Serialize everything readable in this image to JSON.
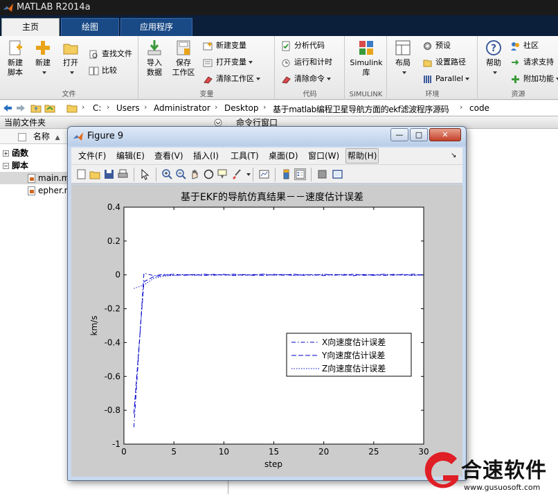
{
  "app": {
    "title": "MATLAB R2014a",
    "tabs": [
      {
        "label": "主页",
        "active": true
      },
      {
        "label": "绘图",
        "active": false
      },
      {
        "label": "应用程序",
        "active": false
      }
    ]
  },
  "ribbon": {
    "file_group": {
      "new_script": "新建\n脚本",
      "new": "新建",
      "open": "打开",
      "find_files": "查找文件",
      "compare": "比较",
      "label": "文件"
    },
    "variable_group": {
      "import_data": "导入\n数据",
      "save_workspace": "保存\n工作区",
      "new_variable": "新建变量",
      "open_variable": "打开变量",
      "clear_workspace": "清除工作区",
      "label": "变量"
    },
    "code_group": {
      "analyze_code": "分析代码",
      "run_and_time": "运行和计时",
      "clear_commands": "清除命令",
      "label": "代码"
    },
    "simulink_group": {
      "simulink_lib": "Simulink\n库",
      "label": "SIMULINK"
    },
    "env_group": {
      "layout": "布局",
      "preferences": "预设",
      "set_path": "设置路径",
      "parallel": "Parallel",
      "label": "环境"
    },
    "resources_group": {
      "help": "帮助",
      "community": "社区",
      "request_support": "请求支持",
      "add_ons": "附加功能",
      "label": "资源"
    }
  },
  "address": {
    "crumbs": [
      "C:",
      "Users",
      "Administrator",
      "Desktop",
      "基于matlab编程卫星导航方面的ekf滤波程序源码",
      "code"
    ]
  },
  "left_panel": {
    "title": "当前文件夹",
    "column_name": "名称",
    "column_sort": "▲",
    "rows": [
      {
        "label": "函数",
        "type": "group",
        "expander": "+"
      },
      {
        "label": "脚本",
        "type": "group",
        "expander": "−"
      },
      {
        "label": "main.m",
        "type": "file"
      },
      {
        "label": "epher.m",
        "type": "file"
      }
    ]
  },
  "command_window": {
    "title": "命令行窗口"
  },
  "figure": {
    "title": "Figure 9",
    "menu": [
      "文件(F)",
      "编辑(E)",
      "查看(V)",
      "插入(I)",
      "工具(T)",
      "桌面(D)",
      "窗口(W)",
      "帮助(H)"
    ],
    "highlighted_menu_index": 7,
    "min_glyph": "—",
    "max_glyph": "□",
    "close_glyph": "✕",
    "toolbar_icons": [
      "new-figure-icon",
      "open-file-icon",
      "save-icon",
      "print-icon",
      "pointer-icon",
      "zoom-in-icon",
      "zoom-out-icon",
      "pan-icon",
      "rotate-3d-icon",
      "data-cursor-icon",
      "brush-icon",
      "link-plot-icon",
      "colorbar-icon",
      "legend-icon",
      "hide-plot-tools-icon",
      "show-plot-tools-icon"
    ]
  },
  "chart_data": {
    "type": "line",
    "title": "基于EKF的导航仿真结果－－速度估计误差",
    "xlabel": "step",
    "ylabel": "km/s",
    "xlim": [
      0,
      30
    ],
    "ylim": [
      -1,
      0.4
    ],
    "xticks": [
      0,
      5,
      10,
      15,
      20,
      25,
      30
    ],
    "yticks": [
      -1,
      -0.8,
      -0.6,
      -0.4,
      -0.2,
      0,
      0.2,
      0.4
    ],
    "legend_position": "lower-right",
    "series": [
      {
        "name": "X向速度估计误差",
        "style": "dashdot",
        "color": "#0000cc",
        "x": [
          1,
          2,
          3,
          4,
          5,
          6,
          7,
          8,
          9,
          10,
          11,
          12,
          13,
          14,
          15,
          16,
          17,
          18,
          19,
          20,
          21,
          22,
          23,
          24,
          25,
          26,
          27,
          28,
          29,
          30
        ],
        "y": [
          -0.9,
          0.01,
          -0.005,
          0.003,
          -0.004,
          0.002,
          -0.003,
          0.004,
          -0.002,
          0.003,
          -0.004,
          0.002,
          -0.003,
          0.005,
          -0.002,
          0.003,
          -0.004,
          0.002,
          -0.003,
          0.004,
          -0.002,
          0.003,
          -0.005,
          0.002,
          -0.003,
          0.004,
          -0.002,
          0.003,
          -0.004,
          0.002
        ]
      },
      {
        "name": "Y向速度估计误差",
        "style": "dashed",
        "color": "#0000cc",
        "x": [
          1,
          2,
          3,
          4,
          5,
          6,
          7,
          8,
          9,
          10,
          11,
          12,
          13,
          14,
          15,
          16,
          17,
          18,
          19,
          20,
          21,
          22,
          23,
          24,
          25,
          26,
          27,
          28,
          29,
          30
        ],
        "y": [
          -0.82,
          -0.04,
          -0.01,
          -0.002,
          0.004,
          -0.003,
          0.002,
          -0.004,
          0.003,
          -0.002,
          0.004,
          -0.003,
          0.002,
          -0.004,
          0.003,
          -0.002,
          0.004,
          -0.003,
          0.002,
          -0.004,
          0.003,
          -0.002,
          0.004,
          -0.003,
          0.002,
          -0.004,
          0.003,
          -0.002,
          0.004,
          -0.003
        ]
      },
      {
        "name": "Z向速度估计误差",
        "style": "dotted",
        "color": "#0000cc",
        "x": [
          1,
          2,
          3,
          4,
          5,
          6,
          7,
          8,
          9,
          10,
          11,
          12,
          13,
          14,
          15,
          16,
          17,
          18,
          19,
          20,
          21,
          22,
          23,
          24,
          25,
          26,
          27,
          28,
          29,
          30
        ],
        "y": [
          -0.08,
          -0.06,
          -0.02,
          -0.008,
          -0.003,
          0.002,
          -0.002,
          0.003,
          -0.002,
          0.002,
          -0.003,
          0.002,
          -0.002,
          0.003,
          -0.002,
          0.002,
          -0.003,
          0.002,
          -0.002,
          0.003,
          -0.002,
          0.002,
          -0.003,
          0.002,
          -0.002,
          0.003,
          -0.002,
          0.002,
          -0.003,
          0.002
        ]
      }
    ]
  },
  "watermark": {
    "text": "合速软件",
    "url": "www.gusuosoft.com"
  },
  "colors": {
    "accent": "#1a4a86",
    "watermark_red": "#e01e26"
  }
}
